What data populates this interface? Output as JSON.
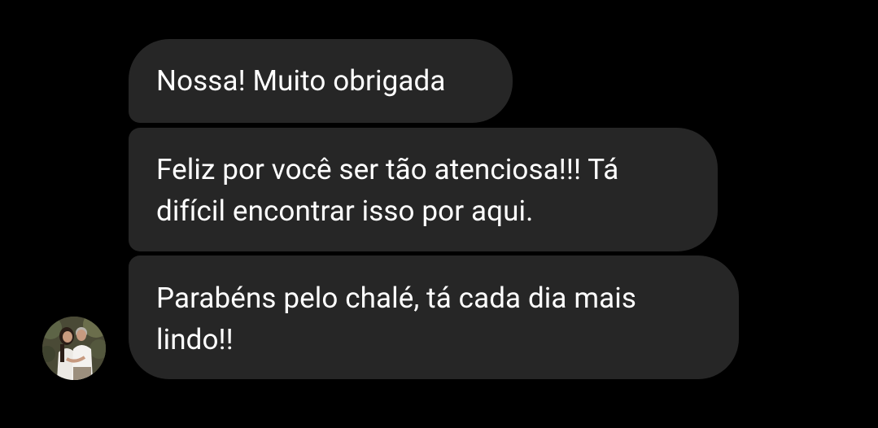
{
  "conversation": {
    "messages": [
      {
        "text": "Nossa! Muito obrigada"
      },
      {
        "text": "Feliz por você ser tão atenciosa!!! Tá difícil encontrar isso por aqui."
      },
      {
        "text": "Parabéns pelo chalé, tá cada dia mais lindo!!"
      }
    ],
    "avatar_icon": "profile-photo-couple"
  },
  "colors": {
    "background": "#000000",
    "bubble": "#262626",
    "text": "#ffffff"
  }
}
